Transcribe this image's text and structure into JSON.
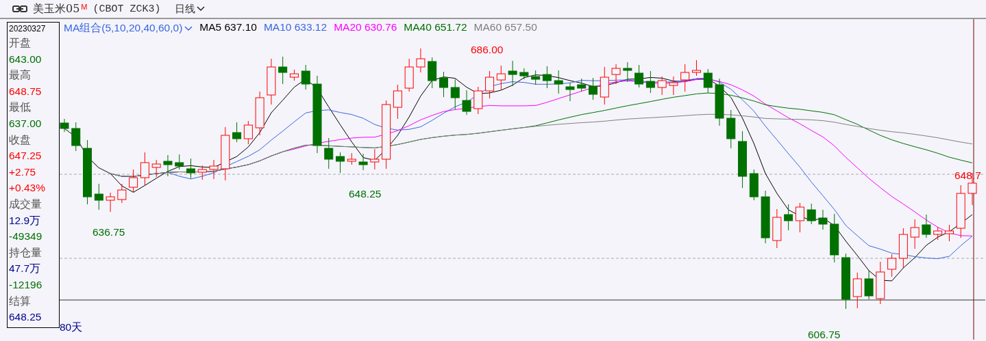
{
  "header": {
    "name": "美玉米05",
    "badge": "M",
    "code": "(CBOT ZCK3)",
    "period": "日线"
  },
  "quote_panel": {
    "date": "20230327",
    "rows": [
      {
        "text": "开盘",
        "color": "#555555"
      },
      {
        "text": "643.00",
        "color": "#007000"
      },
      {
        "text": "最高",
        "color": "#555555"
      },
      {
        "text": "648.75",
        "color": "#ff0000"
      },
      {
        "text": "最低",
        "color": "#555555"
      },
      {
        "text": "637.00",
        "color": "#007000"
      },
      {
        "text": "收盘",
        "color": "#555555"
      },
      {
        "text": "647.25",
        "color": "#ff0000"
      },
      {
        "text": "+2.75",
        "color": "#ff0000"
      },
      {
        "text": "+0.43%",
        "color": "#ff0000"
      },
      {
        "text": "成交量",
        "color": "#555555"
      },
      {
        "text": "12.9万",
        "color": "#00008b"
      },
      {
        "text": "-49349",
        "color": "#007000"
      },
      {
        "text": "持仓量",
        "color": "#555555"
      },
      {
        "text": "47.7万",
        "color": "#00008b"
      },
      {
        "text": "-12196",
        "color": "#007000"
      },
      {
        "text": "结算",
        "color": "#555555"
      },
      {
        "text": "648.25",
        "color": "#00008b"
      }
    ]
  },
  "legend": {
    "selector": "MA组合(5,10,20,40,60,0)",
    "items": [
      {
        "text": "MA5 637.10",
        "color": "#000000"
      },
      {
        "text": "MA10 633.12",
        "color": "#3a66e0"
      },
      {
        "text": "MA20 630.76",
        "color": "#ff00ff"
      },
      {
        "text": "MA40 651.72",
        "color": "#007000"
      },
      {
        "text": "MA60 657.50",
        "color": "#808080"
      }
    ]
  },
  "price_labels": [
    {
      "text": "686.00",
      "kind": "high"
    },
    {
      "text": "636.75",
      "kind": "low"
    },
    {
      "text": "648.25",
      "kind": "low"
    },
    {
      "text": "606.75",
      "kind": "low"
    },
    {
      "text": "648.7",
      "kind": "high"
    }
  ],
  "range_label": "80天"
}
